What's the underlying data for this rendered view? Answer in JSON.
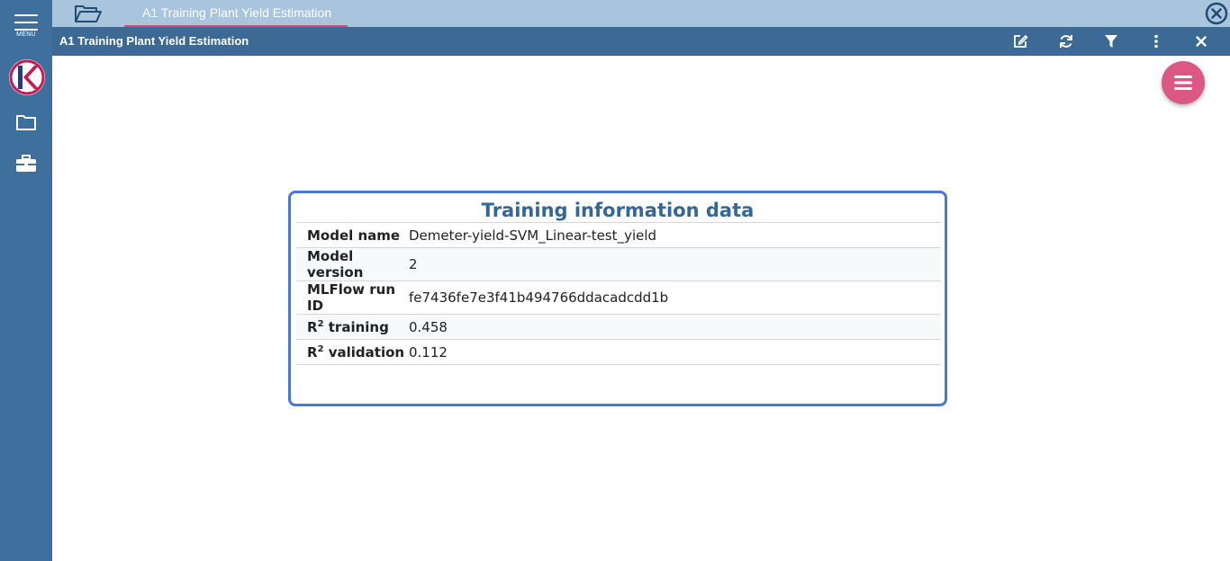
{
  "sidebar": {
    "menu_label": "MENU",
    "logo_letter": "K",
    "icons": [
      "folder-icon",
      "briefcase-icon"
    ]
  },
  "tabbar": {
    "tab_label": "A1 Training Plant Yield Estimation"
  },
  "titlebar": {
    "title": "A1 Training Plant Yield Estimation",
    "actions": [
      "edit-icon",
      "refresh-icon",
      "filter-icon",
      "more-vertical-icon",
      "close-icon"
    ]
  },
  "card": {
    "title": "Training information data",
    "rows": [
      {
        "key": "Model name",
        "value": "Demeter-yield-SVM_Linear-test_yield"
      },
      {
        "key": "Model version",
        "value": "2"
      },
      {
        "key": "MLFlow run ID",
        "value": "fe7436fe7e3f41b494766ddacadcdd1b"
      },
      {
        "key_prefix": "R",
        "key_sup": "2",
        "key_suffix": " training",
        "value": "0.458"
      },
      {
        "key_prefix": "R",
        "key_sup": "2",
        "key_suffix": " validation",
        "value": "0.112"
      }
    ]
  },
  "colors": {
    "sidebar": "#3f6f9c",
    "tabbar": "#a9c4dd",
    "titlebar": "#3d6a94",
    "accent": "#db5885",
    "card_border": "#4a78d6",
    "card_title": "#336699"
  }
}
